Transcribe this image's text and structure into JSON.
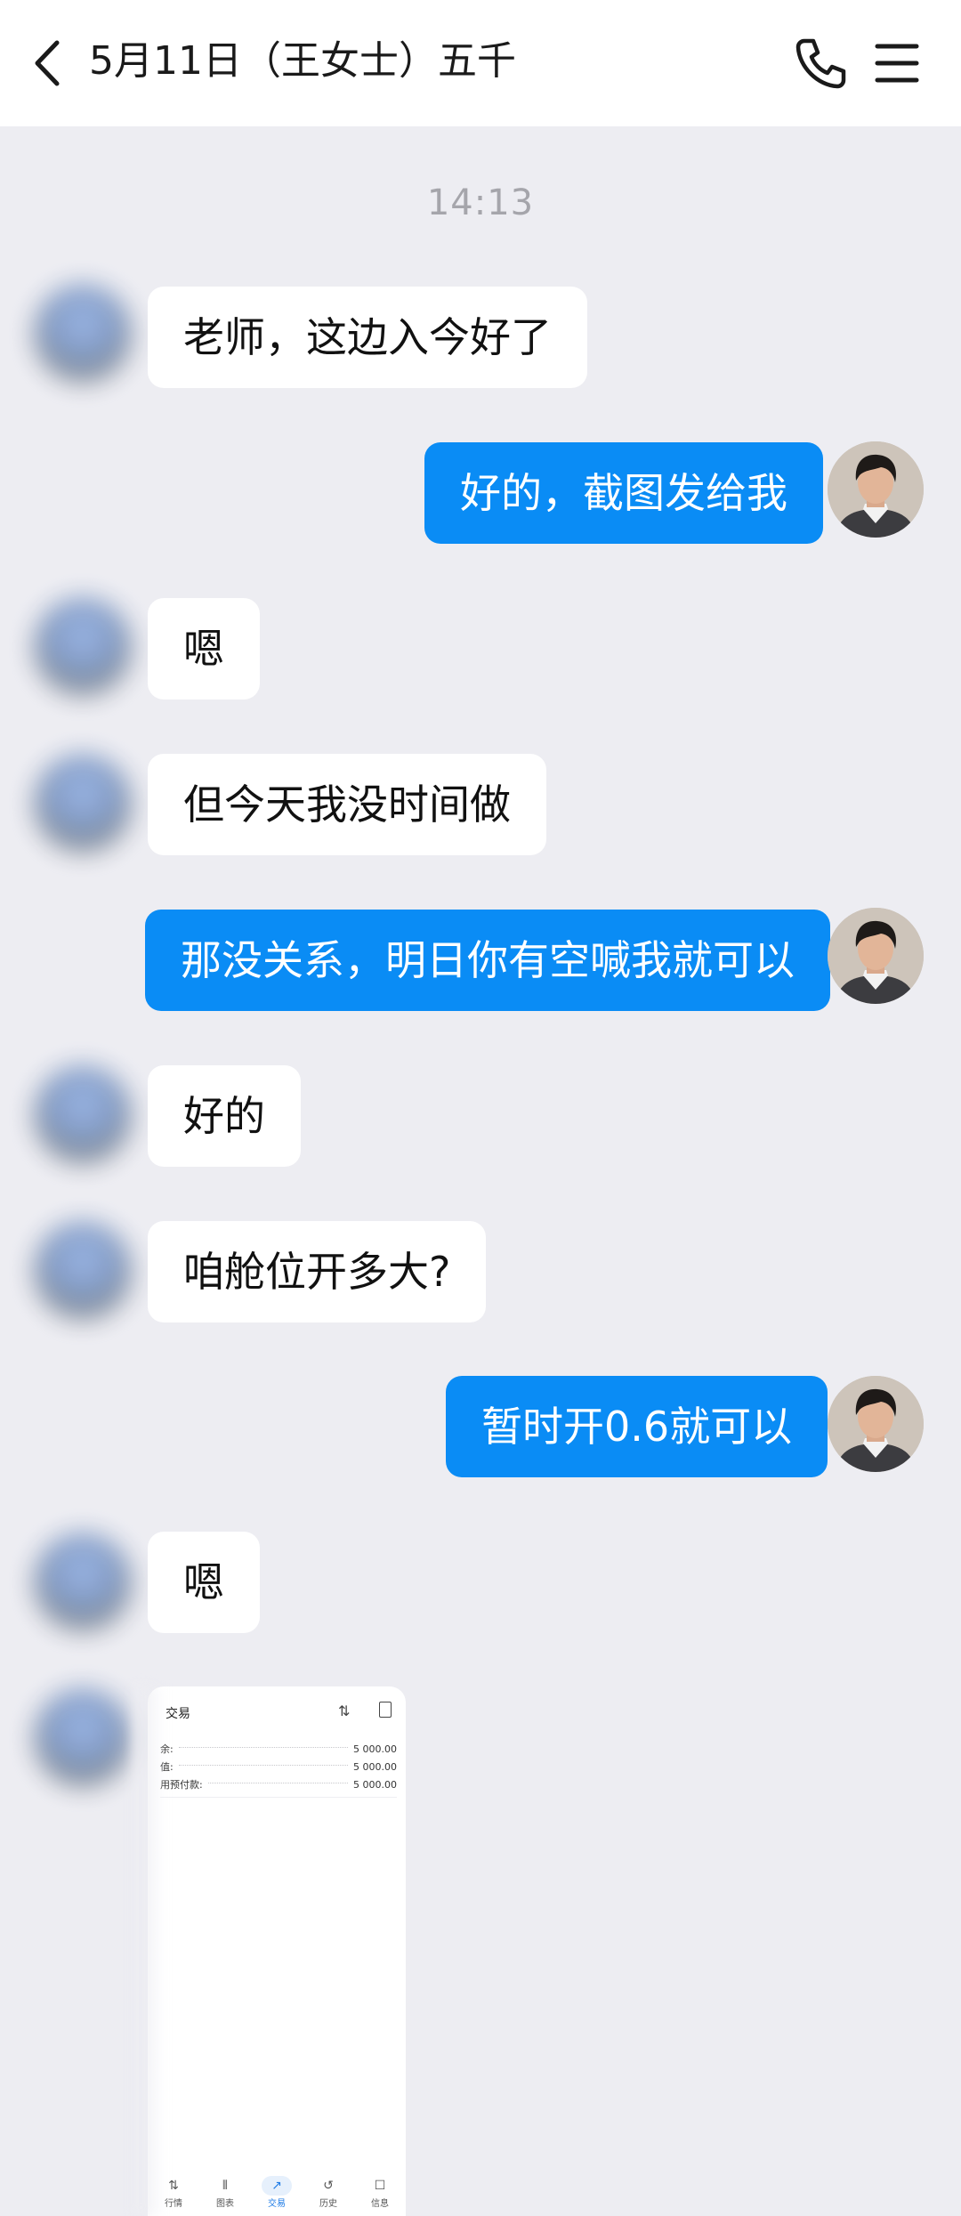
{
  "header": {
    "title": "5月11日（王女士）五千",
    "back_icon": "chevron-left-icon",
    "call_icon": "phone-icon",
    "menu_icon": "hamburger-menu-icon"
  },
  "timestamp": "14:13",
  "messages": [
    {
      "side": "in",
      "text": "老师，这边入今好了"
    },
    {
      "side": "out",
      "text": "好的，截图发给我"
    },
    {
      "side": "in",
      "text": "嗯"
    },
    {
      "side": "in",
      "text": "但今天我没时间做"
    },
    {
      "side": "out",
      "text": "那没关系，明日你有空喊我就可以"
    },
    {
      "side": "in",
      "text": "好的"
    },
    {
      "side": "in",
      "text": "咱舱位开多大?"
    },
    {
      "side": "out",
      "text": "暂时开0.6就可以"
    },
    {
      "side": "in",
      "text": "嗯"
    }
  ],
  "screenshot": {
    "title": "交易",
    "sort_icon": "sort-arrows-icon",
    "doc_icon": "document-add-icon",
    "rows": [
      {
        "label": "余:",
        "value": "5 000.00"
      },
      {
        "label": "值:",
        "value": "5 000.00"
      },
      {
        "label": "用预付款:",
        "value": "5 000.00"
      }
    ],
    "nav": [
      {
        "icon": "⇅",
        "label": "行情"
      },
      {
        "icon": "⫴",
        "label": "图表"
      },
      {
        "icon": "↗",
        "label": "交易",
        "active": true
      },
      {
        "icon": "↺",
        "label": "历史"
      },
      {
        "icon": "☐",
        "label": "信息"
      }
    ]
  },
  "colors": {
    "background": "#EDEDF2",
    "outgoing_bubble": "#0A8CF5",
    "incoming_bubble": "#FFFFFF",
    "timestamp": "#A5A5AB",
    "active_nav": "#1E7BE6"
  }
}
